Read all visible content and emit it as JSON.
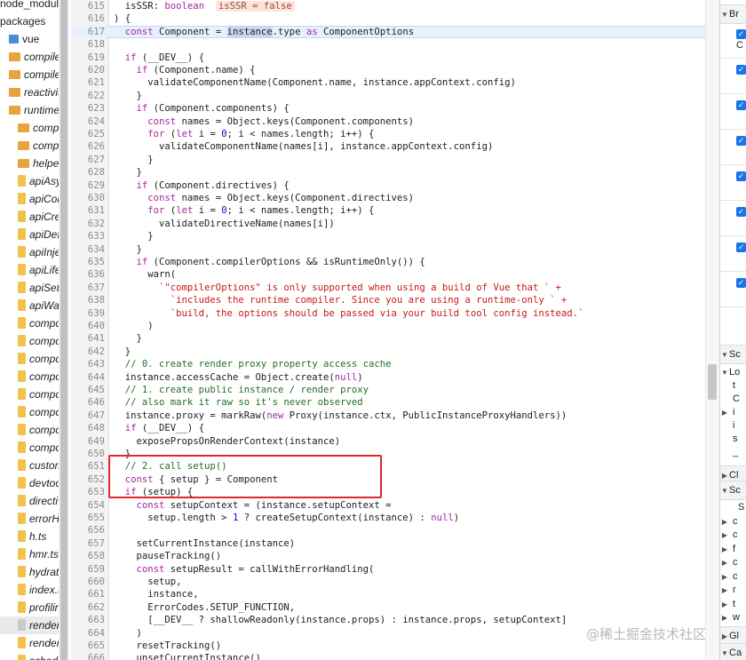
{
  "file_tree": [
    {
      "label": "node_modul",
      "icon": "none",
      "italic": false
    },
    {
      "label": "packages",
      "icon": "none",
      "italic": false
    },
    {
      "label": "vue",
      "icon": "folder-blue",
      "italic": false
    },
    {
      "label": "compiler-c",
      "icon": "folder",
      "italic": true
    },
    {
      "label": "compiler-c",
      "icon": "folder",
      "italic": true
    },
    {
      "label": "reactivity/.",
      "icon": "folder",
      "italic": true
    },
    {
      "label": "runtime-co",
      "icon": "folder",
      "italic": true
    },
    {
      "label": "compat",
      "icon": "folder",
      "italic": true
    },
    {
      "label": "compon",
      "icon": "folder",
      "italic": true
    },
    {
      "label": "helpers",
      "icon": "folder",
      "italic": true
    },
    {
      "label": "apiAsyn",
      "icon": "file",
      "italic": true
    },
    {
      "label": "apiCom",
      "icon": "file",
      "italic": true
    },
    {
      "label": "apiCrea",
      "icon": "file",
      "italic": true
    },
    {
      "label": "apiDefir",
      "icon": "file",
      "italic": true
    },
    {
      "label": "apiInjec",
      "icon": "file",
      "italic": true
    },
    {
      "label": "apiLifec",
      "icon": "file",
      "italic": true
    },
    {
      "label": "apiSetup",
      "icon": "file",
      "italic": true
    },
    {
      "label": "apiWatc",
      "icon": "file",
      "italic": true
    },
    {
      "label": "compon",
      "icon": "file",
      "italic": true
    },
    {
      "label": "compon",
      "icon": "file",
      "italic": true
    },
    {
      "label": "compon",
      "icon": "file",
      "italic": true
    },
    {
      "label": "compon",
      "icon": "file",
      "italic": true
    },
    {
      "label": "compon",
      "icon": "file",
      "italic": true
    },
    {
      "label": "compon",
      "icon": "file",
      "italic": true
    },
    {
      "label": "compon",
      "icon": "file",
      "italic": true
    },
    {
      "label": "compon",
      "icon": "file",
      "italic": true
    },
    {
      "label": "customF",
      "icon": "file",
      "italic": true
    },
    {
      "label": "devtools",
      "icon": "file",
      "italic": true
    },
    {
      "label": "directive",
      "icon": "file",
      "italic": true
    },
    {
      "label": "errorHa",
      "icon": "file",
      "italic": true
    },
    {
      "label": "h.ts",
      "icon": "file",
      "italic": true
    },
    {
      "label": "hmr.ts",
      "icon": "file",
      "italic": true
    },
    {
      "label": "hydratic",
      "icon": "file",
      "italic": true
    },
    {
      "label": "index.ts",
      "icon": "file",
      "italic": true
    },
    {
      "label": "profiling",
      "icon": "file",
      "italic": true
    },
    {
      "label": "rendere",
      "icon": "file-gray",
      "italic": true,
      "selected": true
    },
    {
      "label": "rendere",
      "icon": "file",
      "italic": true
    },
    {
      "label": "scheduler",
      "icon": "file",
      "italic": true
    }
  ],
  "code_lines": [
    {
      "n": "615",
      "html": "  isSSR<span class=\"tk-def\">: </span><span class=\"tk-kw\">boolean</span>  <span class=\"tk-badge\">isSSR = false</span>"
    },
    {
      "n": "616",
      "html": ") {"
    },
    {
      "n": "617",
      "html": "  <span class=\"tk-kw\">const</span> Component = <span class=\"tk-hl\">instance</span>.type <span class=\"tk-kw\">as</span> ComponentOptions",
      "current": true
    },
    {
      "n": "618",
      "html": ""
    },
    {
      "n": "619",
      "html": "  <span class=\"tk-kw\">if</span> (__DEV__) {"
    },
    {
      "n": "620",
      "html": "    <span class=\"tk-kw\">if</span> (Component.name) {"
    },
    {
      "n": "621",
      "html": "      validateComponentName(Component.name, instance.appContext.config)"
    },
    {
      "n": "622",
      "html": "    }"
    },
    {
      "n": "623",
      "html": "    <span class=\"tk-kw\">if</span> (Component.components) {"
    },
    {
      "n": "624",
      "html": "      <span class=\"tk-kw\">const</span> names = Object.keys(Component.components)"
    },
    {
      "n": "625",
      "html": "      <span class=\"tk-kw\">for</span> (<span class=\"tk-kw\">let</span> i = <span class=\"tk-num\">0</span>; i &lt; names.length; i++) {"
    },
    {
      "n": "626",
      "html": "        validateComponentName(names[i], instance.appContext.config)"
    },
    {
      "n": "627",
      "html": "      }"
    },
    {
      "n": "628",
      "html": "    }"
    },
    {
      "n": "629",
      "html": "    <span class=\"tk-kw\">if</span> (Component.directives) {"
    },
    {
      "n": "630",
      "html": "      <span class=\"tk-kw\">const</span> names = Object.keys(Component.directives)"
    },
    {
      "n": "631",
      "html": "      <span class=\"tk-kw\">for</span> (<span class=\"tk-kw\">let</span> i = <span class=\"tk-num\">0</span>; i &lt; names.length; i++) {"
    },
    {
      "n": "632",
      "html": "        validateDirectiveName(names[i])"
    },
    {
      "n": "633",
      "html": "      }"
    },
    {
      "n": "634",
      "html": "    }"
    },
    {
      "n": "635",
      "html": "    <span class=\"tk-kw\">if</span> (Component.compilerOptions &amp;&amp; isRuntimeOnly()) {"
    },
    {
      "n": "636",
      "html": "      warn("
    },
    {
      "n": "637",
      "html": "        <span class=\"tk-str\">`\"compilerOptions\" is only supported when using a build of Vue that ` +</span>"
    },
    {
      "n": "638",
      "html": "          <span class=\"tk-str\">`includes the runtime compiler. Since you are using a runtime-only ` +</span>"
    },
    {
      "n": "639",
      "html": "          <span class=\"tk-str\">`build, the options should be passed via your build tool config instead.`</span>"
    },
    {
      "n": "640",
      "html": "      )"
    },
    {
      "n": "641",
      "html": "    }"
    },
    {
      "n": "642",
      "html": "  }"
    },
    {
      "n": "643",
      "html": "  <span class=\"tk-com\">// 0. create render proxy property access cache</span>"
    },
    {
      "n": "644",
      "html": "  instance.accessCache = Object.create(<span class=\"tk-kw\">null</span>)"
    },
    {
      "n": "645",
      "html": "  <span class=\"tk-com\">// 1. create public instance / render proxy</span>"
    },
    {
      "n": "646",
      "html": "  <span class=\"tk-com\">// also mark it raw so it's never observed</span>"
    },
    {
      "n": "647",
      "html": "  instance.proxy = markRaw(<span class=\"tk-kw\">new</span> Proxy(instance.ctx, PublicInstanceProxyHandlers))"
    },
    {
      "n": "648",
      "html": "  <span class=\"tk-kw\">if</span> (__DEV__) {"
    },
    {
      "n": "649",
      "html": "    exposePropsOnRenderContext(instance)"
    },
    {
      "n": "650",
      "html": "  }"
    },
    {
      "n": "651",
      "html": "  <span class=\"tk-com\">// 2. call setup()</span>"
    },
    {
      "n": "652",
      "html": "  <span class=\"tk-kw\">const</span> { setup } = Component"
    },
    {
      "n": "653",
      "html": "  <span class=\"tk-kw\">if</span> (setup) {"
    },
    {
      "n": "654",
      "html": "    <span class=\"tk-kw\">const</span> setupContext = (instance.setupContext ="
    },
    {
      "n": "655",
      "html": "      setup.length &gt; <span class=\"tk-num\">1</span> ? createSetupContext(instance) : <span class=\"tk-kw\">null</span>)"
    },
    {
      "n": "656",
      "html": ""
    },
    {
      "n": "657",
      "html": "    setCurrentInstance(instance)"
    },
    {
      "n": "658",
      "html": "    pauseTracking()"
    },
    {
      "n": "659",
      "html": "    <span class=\"tk-kw\">const</span> setupResult = callWithErrorHandling("
    },
    {
      "n": "660",
      "html": "      setup,"
    },
    {
      "n": "661",
      "html": "      instance,"
    },
    {
      "n": "662",
      "html": "      ErrorCodes.SETUP_FUNCTION,"
    },
    {
      "n": "663",
      "html": "      [__DEV__ ? shallowReadonly(instance.props) : instance.props, setupContext]"
    },
    {
      "n": "664",
      "html": "    )"
    },
    {
      "n": "665",
      "html": "    resetTracking()"
    },
    {
      "n": "666",
      "html": "    unsetCurrentInstance()"
    }
  ],
  "right_panel": {
    "breakpoints_title": "Br",
    "breakpoint_count": 8,
    "breakpoint_check": "✓",
    "breakpoint_text": "C",
    "scope_title": "Sc",
    "scope_rows": [
      {
        "tri": "▼",
        "text": "Lo"
      },
      {
        "tri": "",
        "text": "t"
      },
      {
        "tri": "",
        "text": "C"
      },
      {
        "tri": "▶",
        "text": "i"
      },
      {
        "tri": "",
        "text": "i"
      },
      {
        "tri": "",
        "text": "s"
      },
      {
        "tri": "",
        "text": "_"
      }
    ],
    "closure_title": "Cl",
    "script_title": "Sc",
    "script_rows": [
      {
        "tri": "",
        "text": "S"
      },
      {
        "tri": "▶",
        "text": "c"
      },
      {
        "tri": "▶",
        "text": "c"
      },
      {
        "tri": "▶",
        "text": "f"
      },
      {
        "tri": "▶",
        "text": "c"
      },
      {
        "tri": "▶",
        "text": "c"
      },
      {
        "tri": "▶",
        "text": "r"
      },
      {
        "tri": "▶",
        "text": "t"
      },
      {
        "tri": "▶",
        "text": "w"
      }
    ],
    "global_title": "Gl",
    "callstack_title": "Ca"
  },
  "watermark": "@稀土掘金技术社区"
}
